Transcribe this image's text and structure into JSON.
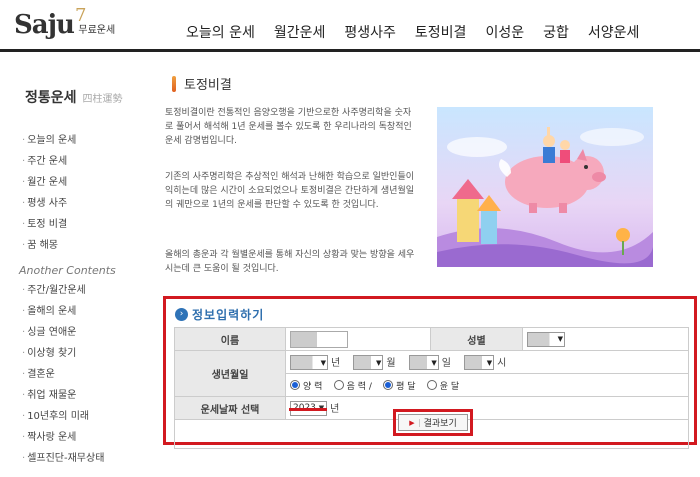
{
  "logo": {
    "main": "Saju",
    "seven": "7",
    "sub": "무료운세"
  },
  "nav": [
    "오늘의 운세",
    "월간운세",
    "평생사주",
    "토정비결",
    "이성운",
    "궁합",
    "서양운세"
  ],
  "sidebar": {
    "title": "정통운세",
    "title_sub": "四柱運勢",
    "items": [
      "오늘의 운세",
      "주간 운세",
      "월간 운세",
      "평생 사주",
      "토정 비결",
      "꿈 해몽"
    ],
    "section_title": "Another Contents",
    "other_items": [
      "주간/월간운세",
      "올해의 운세",
      "싱글 연애운",
      "이상형 찾기",
      "결혼운",
      "취업 재물운",
      "10년후의 미래",
      "짝사랑 운세",
      "셀프진단-재무상태"
    ]
  },
  "content": {
    "title": "토정비결",
    "paragraphs": [
      "토정비결이란 전통적인 음양오행을 기반으로한 사주명리학을 숫자로 풀어서 해석해 1년 운세를 볼수 있도록 한 우리나라의 독창적인 운세 감명법입니다.",
      "기존의 사주명리학은 추상적인 해석과 난해한 학습으로 일반인들이 익히는데 많은 시간이 소요되었으나 토정비결은 간단하게 생년월일의 궤만으로 1년의 운세를 판단할 수 있도록 한 것입니다.",
      "올해의 총운과 각 월별운세를 통해 자신의 상황과 맞는 방향을 세우시는데 큰 도움이 될 것입니다."
    ]
  },
  "form": {
    "title": "정보입력하기",
    "name_label": "이름",
    "gender_label": "성별",
    "birth_label": "생년월일",
    "unit_year": "년",
    "unit_month": "월",
    "unit_day": "일",
    "unit_hour": "시",
    "calendar_options": [
      "양 력",
      "음 력 /",
      "평 달",
      "윤 달"
    ],
    "fortune_year_label": "운세날짜 선택",
    "fortune_year_value": "2023",
    "fortune_year_unit": "년",
    "result_button": "결과보기"
  },
  "colors": {
    "highlight": "#d21920",
    "form_title": "#2f6fae"
  }
}
